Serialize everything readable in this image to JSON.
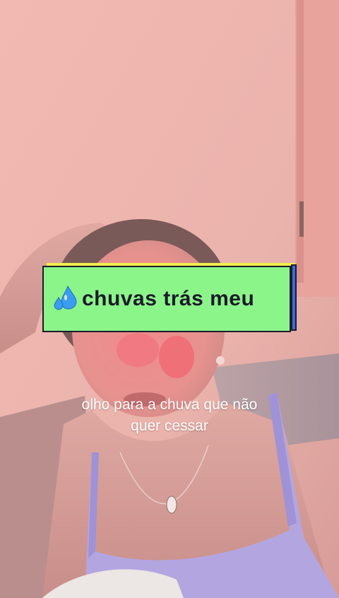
{
  "sticker": {
    "icon": "sweat-droplets-icon",
    "text": "chuvas trás meu",
    "background_color": "#8cf58a",
    "shadow_color": "#f2ee4c",
    "side_color": "#3d6be0"
  },
  "caption": {
    "line1": "olho para a chuva que não",
    "line2": "quer cessar"
  }
}
